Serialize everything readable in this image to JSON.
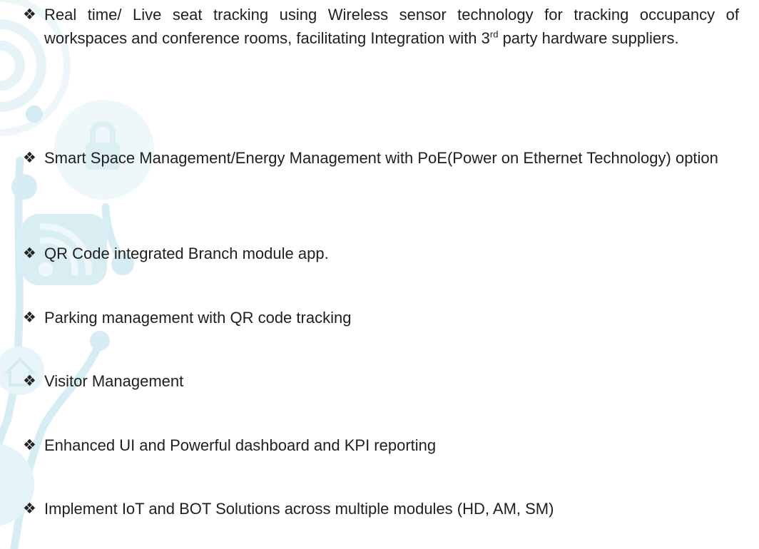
{
  "bullets": [
    {
      "marker": "❖",
      "text_before_sup": "Real time/ Live seat tracking using Wireless sensor technology for tracking occupancy of workspaces and conference rooms, facilitating Integration with 3",
      "sup": "rd",
      "text_after_sup": " party hardware suppliers."
    },
    {
      "marker": "❖",
      "text": "Smart Space Management/Energy Management with PoE(Power on Ethernet Technology) option"
    },
    {
      "marker": "❖",
      "text": "QR Code integrated Branch module app."
    },
    {
      "marker": "❖",
      "text": "Parking management with QR code tracking"
    },
    {
      "marker": "❖",
      "text": "Visitor Management"
    },
    {
      "marker": "❖",
      "text": "Enhanced UI and Powerful dashboard and KPI reporting"
    },
    {
      "marker": "❖",
      "text": "Implement IoT and BOT Solutions across multiple modules (HD, AM, SM)"
    }
  ],
  "decor": {
    "color_light": "#e8f5f8",
    "color_mid": "#d8eff4",
    "color_line": "#cfeaf0",
    "icons": [
      "wifi-signal-icon",
      "lock-icon",
      "rss-icon",
      "home-icon"
    ]
  }
}
